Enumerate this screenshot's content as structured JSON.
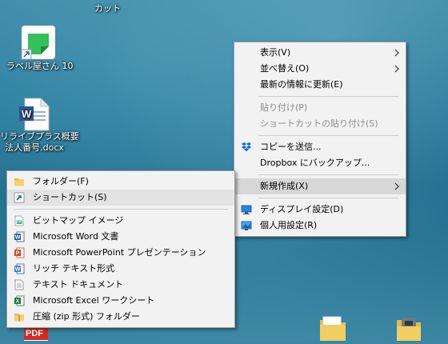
{
  "desktop": {
    "top_label": "カット",
    "icons": [
      {
        "label_lines": [
          "ラベル屋さん 10"
        ]
      },
      {
        "label_lines": [
          "リライブプラス概要",
          "法人番号.docx"
        ]
      }
    ]
  },
  "context_menu": {
    "items": [
      {
        "label": "表示(V)"
      },
      {
        "label": "並べ替え(O)"
      },
      {
        "label": "最新の情報に更新(E)"
      },
      {
        "label": "貼り付け(P)"
      },
      {
        "label": "ショートカットの貼り付け(S)"
      },
      {
        "label": "コピーを送信..."
      },
      {
        "label": "Dropbox にバックアップ..."
      },
      {
        "label": "新規作成(X)"
      },
      {
        "label": "ディスプレイ設定(D)"
      },
      {
        "label": "個人用設定(R)"
      }
    ]
  },
  "submenu": {
    "items": [
      {
        "label": "フォルダー(F)"
      },
      {
        "label": "ショートカット(S)"
      },
      {
        "label": "ビットマップ イメージ"
      },
      {
        "label": "Microsoft Word 文書"
      },
      {
        "label": "Microsoft PowerPoint プレゼンテーション"
      },
      {
        "label": "リッチ テキスト形式"
      },
      {
        "label": "テキスト ドキュメント"
      },
      {
        "label": "Microsoft Excel ワークシート"
      },
      {
        "label": "圧縮 (zip 形式) フォルダー"
      }
    ]
  },
  "colors": {
    "menu_bg": "#f2f2f2",
    "highlight": "#d7d7d7",
    "disabled_text": "#8d8d8d",
    "word_blue": "#2b579a",
    "excel_green": "#217346",
    "powerpoint_red": "#d24726",
    "dropbox_blue": "#0061ff"
  }
}
